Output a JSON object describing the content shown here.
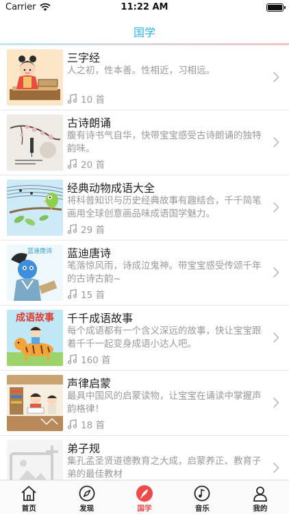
{
  "status": {
    "carrier": "Carrier",
    "time": "11:22 AM"
  },
  "nav": {
    "title": "国学"
  },
  "items": [
    {
      "title": "三字经",
      "desc": "人之初，性本善。性相近，习相远。",
      "count": "10 首"
    },
    {
      "title": "古诗朗诵",
      "desc": "腹有诗书气自华，快带宝宝感受古诗朗诵的独特韵味。",
      "count": "20 首"
    },
    {
      "title": "经典动物成语大全",
      "desc": "将科普知识与历史经典故事有趣结合，千千简笔画用全球创意画品味成语国学魅力。",
      "count": "29 首"
    },
    {
      "title": "蓝迪唐诗",
      "desc": "笔落惊风雨，诗成泣鬼神。带宝宝感受传颂千年的古诗古韵~",
      "count": "15 首"
    },
    {
      "title": "千千成语故事",
      "desc": "每个成语都有一个含义深远的故事，快让宝宝跟着千千一起变身成语小达人吧。",
      "count": "160 首"
    },
    {
      "title": "声律启蒙",
      "desc": "最具中国风的启蒙读物，让宝宝在诵读中掌握声韵格律！",
      "count": "18 首"
    },
    {
      "title": "弟子规",
      "desc": "集孔孟圣贤道德教育之大成，启蒙养正、教育子弟的最佳教材",
      "count": ""
    }
  ],
  "thumbs": {
    "tang_text": "蓝迪唐诗",
    "idiom_text": "成语故事"
  },
  "tabs": [
    {
      "label": "首页",
      "icon": "home-icon"
    },
    {
      "label": "发现",
      "icon": "compass-icon"
    },
    {
      "label": "国学",
      "icon": "feather-icon",
      "active": true
    },
    {
      "label": "音乐",
      "icon": "music-icon"
    },
    {
      "label": "我的",
      "icon": "person-icon"
    }
  ],
  "colors": {
    "accent": "#2fb4e6",
    "active_tab": "#ef4a4a"
  }
}
